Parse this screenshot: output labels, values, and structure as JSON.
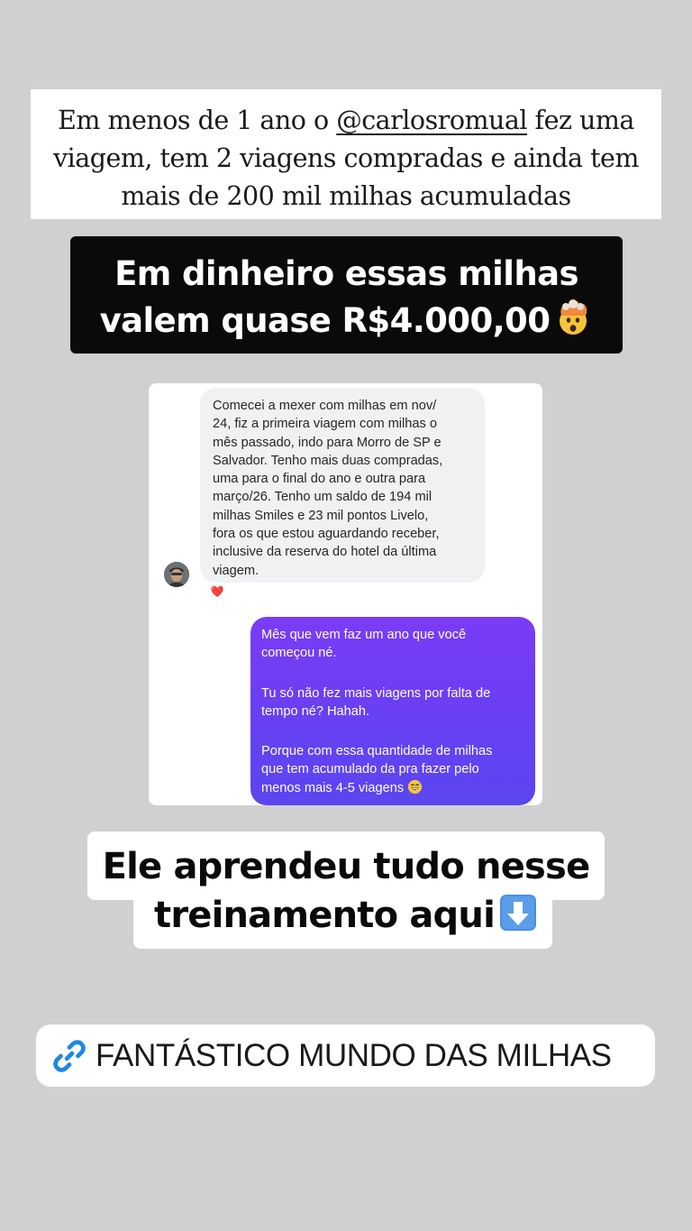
{
  "caption": {
    "before_mention": "Em menos de 1 ano o ",
    "mention": "@carlosromual",
    "after_mention": " fez uma viagem, tem 2 viagens compradas e ainda tem mais de 200 mil milhas acumuladas"
  },
  "headline": {
    "line1": "Em dinheiro essas milhas",
    "line2": "valem quase R$4.000,00",
    "emoji": "exploding-head-emoji"
  },
  "chat": {
    "incoming_message": "Comecei a mexer com milhas em  nov/\n24, fiz a primeira viagem com milhas o\nmês passado, indo para Morro de SP e\nSalvador. Tenho mais duas compradas,\numa para o final do ano e outra para\nmarço/26. Tenho um saldo de 194 mil\nmilhas Smiles e 23 mil pontos Livelo,\nfora os que estou aguardando receber,\ninclusive da reserva do hotel da última\nviagem.",
    "reaction": "❤️",
    "outgoing_messages": [
      "Mês que vem faz um ano que você\ncomeçou né.",
      "Tu só não fez mais viagens por falta de\ntempo né? Hahah.",
      "Porque com essa quantidade de milhas\nque tem acumulado da pra fazer pelo\nmenos mais 4-5 viagens"
    ],
    "outgoing_emoji": "grinning-sweat-emoji",
    "outgoing_color": "#6a3ff3"
  },
  "training": {
    "line1": "Ele aprendeu tudo nesse",
    "line2": "treinamento aqui",
    "emoji": "down-arrow-emoji"
  },
  "link_sticker": {
    "label": "FANTÁSTICO MUNDO DAS MILHAS",
    "icon": "link-icon",
    "icon_color": "#1e88e5"
  }
}
